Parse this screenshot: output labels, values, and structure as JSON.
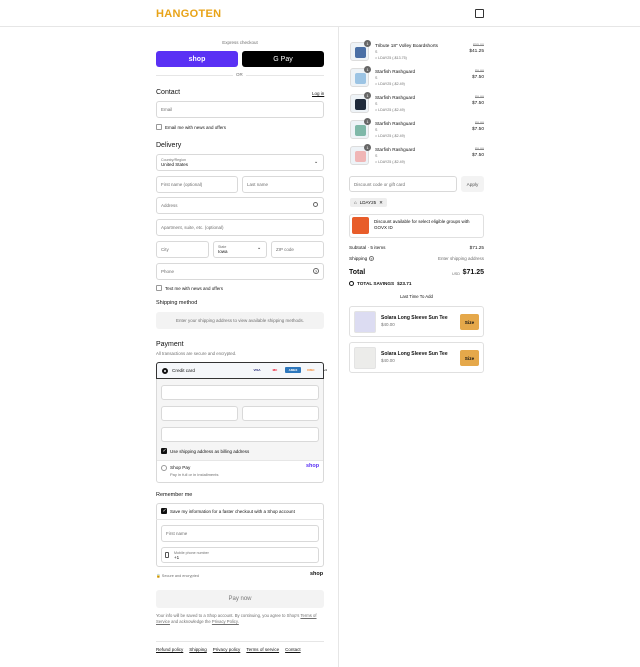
{
  "header": {
    "logo": "HANGOTEN"
  },
  "express": {
    "title": "Express checkout",
    "shop_label": "shop",
    "gpay_label": "G Pay",
    "or": "OR"
  },
  "contact": {
    "title": "Contact",
    "login": "Log in",
    "email_placeholder": "Email",
    "newsletter": "Email me with news and offers"
  },
  "delivery": {
    "title": "Delivery",
    "country_label": "Country/Region",
    "country_value": "United States",
    "first_name": "First name (optional)",
    "last_name": "Last name",
    "address": "Address",
    "apartment": "Apartment, suite, etc. (optional)",
    "city": "City",
    "state_label": "State",
    "state_value": "Iowa",
    "zip": "ZIP code",
    "phone": "Phone",
    "text_me": "Text me with news and offers"
  },
  "shipping_method": {
    "title": "Shipping method",
    "info": "Enter your shipping address to view available shipping methods."
  },
  "payment": {
    "title": "Payment",
    "subtitle": "All transactions are secure and encrypted.",
    "credit_card": "Credit card",
    "cards": [
      "VISA",
      "MC",
      "AMEX",
      "DISC",
      "+4"
    ],
    "billing_same": "Use shipping address as billing address",
    "shop_pay": "Shop Pay",
    "shop_pay_sub": "Pay in full or in installments",
    "shop_pay_logo": "shop"
  },
  "remember": {
    "title": "Remember me",
    "save_info": "Save my information for a faster checkout with a Shop account",
    "first_name": "First name",
    "phone_label": "Mobile phone number",
    "phone_value": "+1",
    "secure": "Secure and encrypted",
    "shop_logo": "shop"
  },
  "pay_now": "Pay now",
  "legal": {
    "text": "Your info will be saved to a Shop account. By continuing, you agree to Shop's",
    "tos": "Terms of Service",
    "and": "and acknowledge the",
    "privacy": "Privacy Policy."
  },
  "footer_links": [
    "Refund policy",
    "Shipping",
    "Privacy policy",
    "Terms of service",
    "Contact"
  ],
  "cart": {
    "items": [
      {
        "qty": "1",
        "name": "Tribute 18\" Volley Boardshorts",
        "variant": "S",
        "discount": "LDAY25 (-$13.75)",
        "old_price": "$55.00",
        "price": "$41.25",
        "color": "#4a6fa5"
      },
      {
        "qty": "1",
        "name": "Starfish Rashguard",
        "variant": "S",
        "discount": "LDAY25 (-$2.49)",
        "old_price": "$9.99",
        "price": "$7.50",
        "color": "#9cc4e4"
      },
      {
        "qty": "1",
        "name": "Starfish Rashguard",
        "variant": "S",
        "discount": "LDAY25 (-$2.49)",
        "old_price": "$9.99",
        "price": "$7.50",
        "color": "#1f2a3a"
      },
      {
        "qty": "1",
        "name": "Starfish Rashguard",
        "variant": "S",
        "discount": "LDAY25 (-$2.49)",
        "old_price": "$9.99",
        "price": "$7.50",
        "color": "#7fb8a8"
      },
      {
        "qty": "1",
        "name": "Starfish Rashguard",
        "variant": "S",
        "discount": "LDAY25 (-$2.49)",
        "old_price": "$9.99",
        "price": "$7.50",
        "color": "#f0b6b6"
      }
    ],
    "discount_placeholder": "Discount code or gift card",
    "apply": "Apply",
    "applied_code": "LDAY25",
    "govx_text": "Discount available for select eligible groups with GOVX ID",
    "subtotal_label": "Subtotal · 5 items",
    "subtotal_value": "$71.25",
    "shipping_label": "Shipping",
    "shipping_value": "Enter shipping address",
    "total_label": "Total",
    "currency": "USD",
    "total_value": "$71.25",
    "savings_label": "TOTAL SAVINGS",
    "savings_value": "$23.71",
    "upsell_title": "Last Time To Add",
    "upsell": [
      {
        "name": "Solara Long Sleeve Sun Tee",
        "price": "$40.00",
        "button": "Size"
      },
      {
        "name": "Solara Long Sleeve Sun Tee",
        "price": "$40.00",
        "button": "Size"
      }
    ]
  },
  "colors": {
    "accent": "#e8a317",
    "shop_purple": "#5a31f4",
    "size_btn": "#e5a84a"
  }
}
